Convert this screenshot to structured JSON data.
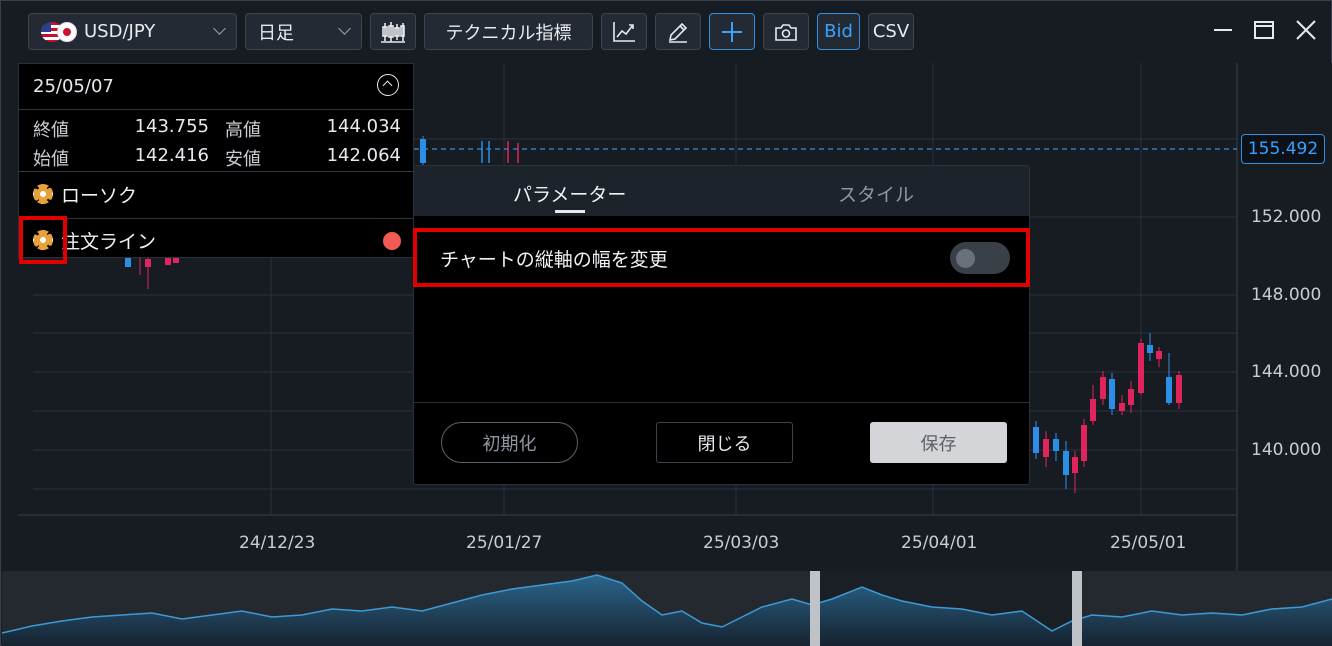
{
  "toolbar": {
    "symbol": "USD/JPY",
    "timeframe": "日足",
    "indicators_label": "テクニカル指標",
    "bid_label": "Bid",
    "csv_label": "CSV"
  },
  "info_panel": {
    "date": "25/05/07",
    "close_label": "終値",
    "close_value": "143.755",
    "high_label": "高値",
    "high_value": "144.034",
    "open_label": "始値",
    "open_value": "142.416",
    "low_label": "安値",
    "low_value": "142.064",
    "layers": [
      {
        "label": "ローソク"
      },
      {
        "label": "注文ライン"
      }
    ]
  },
  "dialog": {
    "tab_parameters": "パラメーター",
    "tab_style": "スタイル",
    "setting_label": "チャートの縦軸の幅を変更",
    "setting_enabled": false,
    "reset_label": "初期化",
    "close_label": "閉じる",
    "save_label": "保存"
  },
  "chart": {
    "current_price": "155.492",
    "y_axis": [
      "152.000",
      "148.000",
      "144.000",
      "140.000"
    ],
    "x_axis": [
      "24/12/23",
      "25/01/27",
      "25/03/03",
      "25/04/01",
      "25/05/01"
    ],
    "up_color": "#2b8fe8",
    "down_color": "#e0245e"
  }
}
